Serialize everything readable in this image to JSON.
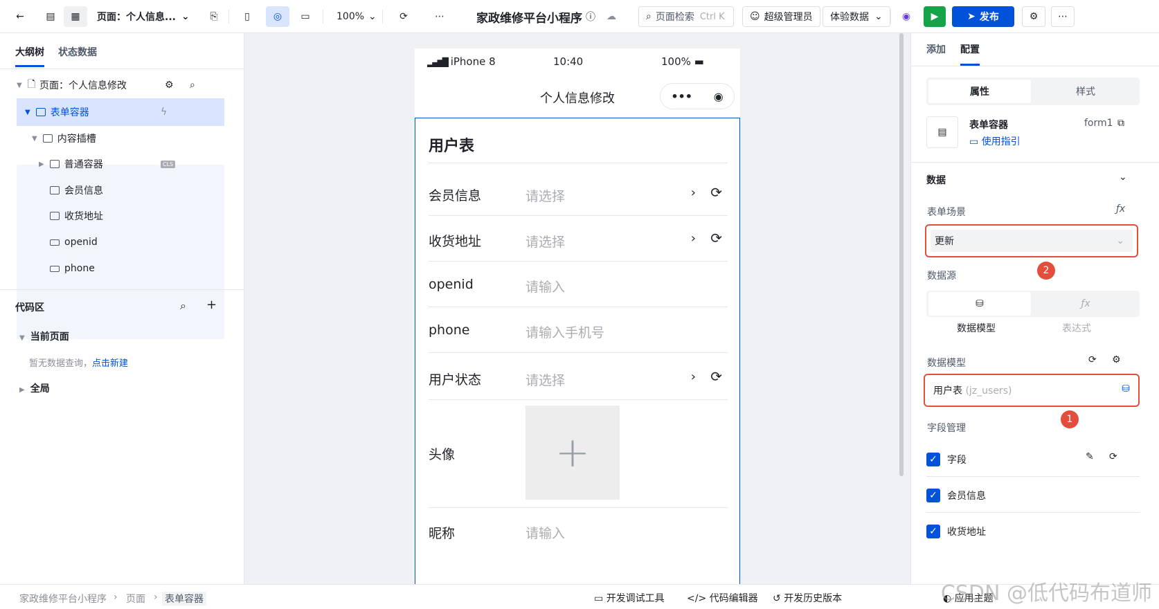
{
  "topbar": {
    "page_label": "页面：个人信息...",
    "zoom": "100%",
    "app_title": "家政维修平台小程序",
    "search_label": "页面检索",
    "search_shortcut": "Ctrl K",
    "admin_label": "超级管理员",
    "env_label": "体验数据",
    "publish_label": "发布"
  },
  "left": {
    "tab_outline": "大纲树",
    "tab_state": "状态数据",
    "tree": [
      {
        "label": "页面：个人信息修改"
      },
      {
        "label": "表单容器"
      },
      {
        "label": "内容插槽"
      },
      {
        "label": "普通容器",
        "tag": "CLS"
      },
      {
        "label": "会员信息"
      },
      {
        "label": "收货地址"
      },
      {
        "label": "openid"
      },
      {
        "label": "phone"
      }
    ],
    "code_title": "代码区",
    "current_page": "当前页面",
    "empty_hint": "暂无数据查询，",
    "create_link": "点击新建",
    "global": "全局"
  },
  "phone": {
    "carrier": "iPhone 8",
    "time": "10:40",
    "battery": "100%",
    "nav_title": "个人信息修改",
    "form_title": "用户表",
    "fields": [
      {
        "label": "会员信息",
        "placeholder": "请选择",
        "select": true
      },
      {
        "label": "收货地址",
        "placeholder": "请选择",
        "select": true
      },
      {
        "label": "openid",
        "placeholder": "请输入",
        "select": false
      },
      {
        "label": "phone",
        "placeholder": "请输入手机号",
        "select": false
      },
      {
        "label": "用户状态",
        "placeholder": "请选择",
        "select": true
      }
    ],
    "avatar_label": "头像",
    "nickname_label": "昵称",
    "nickname_placeholder": "请输入"
  },
  "right": {
    "tab_add": "添加",
    "tab_config": "配置",
    "seg_props": "属性",
    "seg_style": "样式",
    "comp_name": "表单容器",
    "comp_id": "form1",
    "guide": "使用指引",
    "section_data": "数据",
    "scene_label": "表单场景",
    "scene_value": "更新",
    "badge2": "2",
    "source_label": "数据源",
    "source_model": "数据模型",
    "source_expr": "表达式",
    "model_label": "数据模型",
    "model_value": "用户表",
    "model_id": "(jz_users)",
    "badge1": "1",
    "field_mgmt": "字段管理",
    "fields": [
      "字段",
      "会员信息",
      "收货地址"
    ]
  },
  "bottom": {
    "crumbs": [
      "家政维修平台小程序",
      "页面",
      "表单容器"
    ],
    "dev_tools": "开发调试工具",
    "code_editor": "代码编辑器",
    "history": "开发历史版本",
    "theme": "应用主题",
    "watermark": "CSDN @低代码布道师"
  },
  "colors": {
    "primary": "#0052d9",
    "annotation_red": "#e34d3b",
    "run_green": "#16a34a"
  }
}
